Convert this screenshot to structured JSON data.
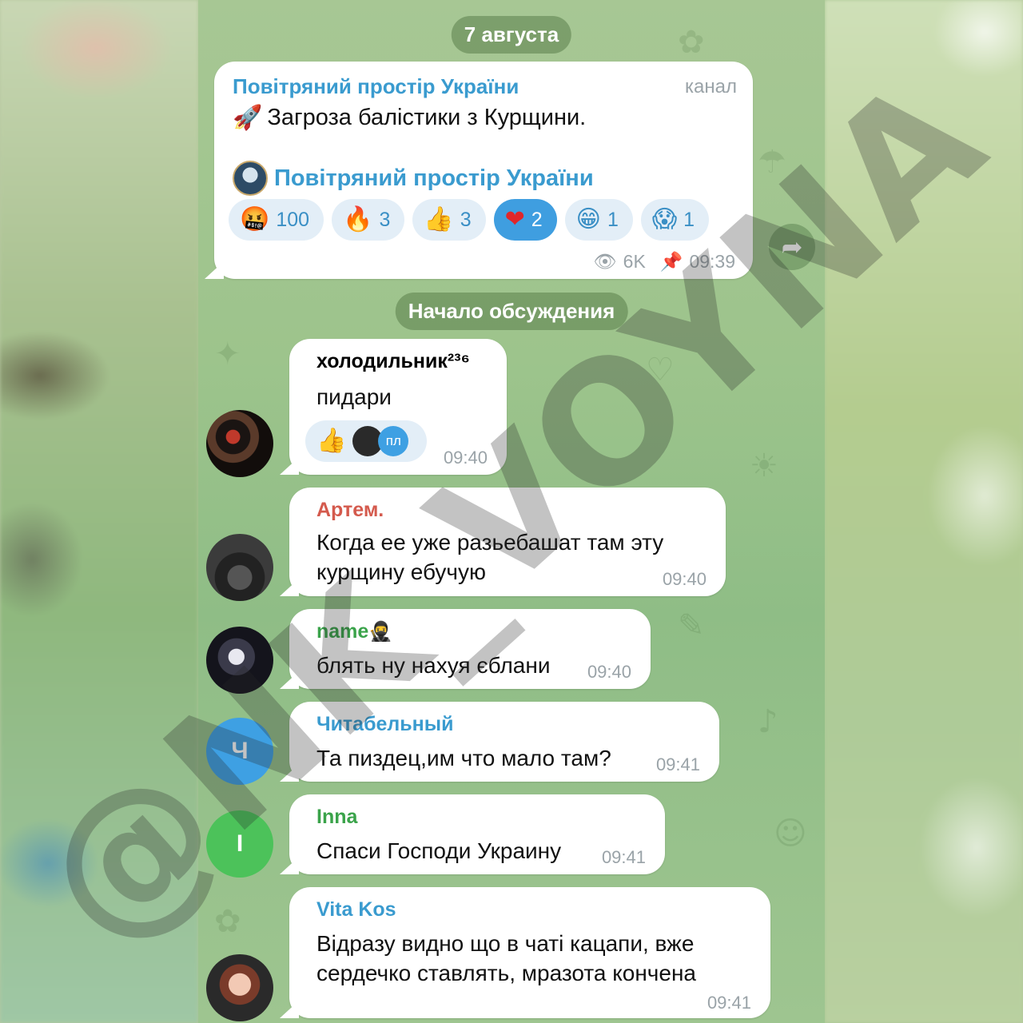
{
  "date_separator": "7 августа",
  "discussion_separator": "Начало обсуждения",
  "channel_post": {
    "channel_name": "Повітряний простір України",
    "type_label": "канал",
    "text": "Загроза балістики з Курщини.",
    "link_name": "Повітряний простір України",
    "reactions": [
      {
        "emoji": "🤬",
        "count": "100",
        "active": false
      },
      {
        "emoji": "🔥",
        "count": "3",
        "active": false
      },
      {
        "emoji": "👍",
        "count": "3",
        "active": false
      },
      {
        "emoji": "❤",
        "count": "2",
        "active": true
      },
      {
        "emoji": "😁",
        "count": "1",
        "active": false
      },
      {
        "emoji": "😱",
        "count": "1",
        "active": false
      }
    ],
    "views": "6K",
    "time": "09:39"
  },
  "messages": [
    {
      "sender": "холодильник²³⁶",
      "sender_color": "#3a9bcf",
      "text_lines": [
        "пидари"
      ],
      "time": "09:40",
      "reaction_emoji": "👍",
      "reaction_user": "пл"
    },
    {
      "sender": "Артем.",
      "sender_color": "#d45a4d",
      "text_lines": [
        "Когда ее уже разьебашат там эту",
        "курщину  ебучую"
      ],
      "time": "09:40"
    },
    {
      "sender": "name",
      "sender_emoji": "🥷",
      "sender_color": "#3aa34a",
      "text_lines": [
        "блять ну нахуя єблани"
      ],
      "time": "09:40"
    },
    {
      "sender": "Читабельный",
      "sender_color": "#3a9bcf",
      "text_lines": [
        "Та пиздец,им что мало там?"
      ],
      "time": "09:41",
      "avatar_letter": "Ч",
      "avatar_color": "#3ea0e3"
    },
    {
      "sender": "Inna",
      "sender_color": "#3aa34a",
      "text_lines": [
        "Спаси Господи Украину"
      ],
      "time": "09:41",
      "avatar_letter": "I",
      "avatar_color": "#4cc25a"
    },
    {
      "sender": "Vita Kos",
      "sender_color": "#3a9bcf",
      "text_lines": [
        "Відразу видно що в  чаті кацапи, вже",
        "сердечко ставлять, мразота кончена"
      ],
      "time": "09:41"
    }
  ],
  "watermark": "@NK_VOYNA",
  "colors": {
    "accent": "#3a9bcf",
    "active_reaction": "#3f9ee0",
    "wallpaper": "#9dc48c"
  }
}
